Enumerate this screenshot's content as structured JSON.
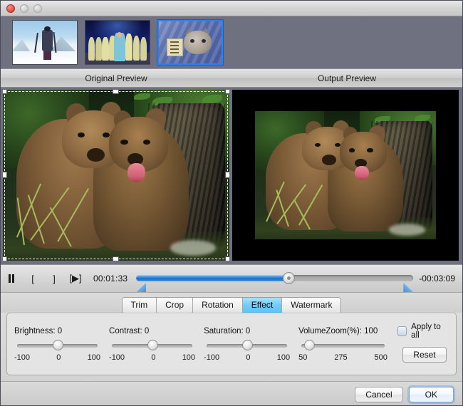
{
  "window": {
    "traffic_lights": [
      "close",
      "minimize",
      "zoom"
    ]
  },
  "thumbnails": [
    {
      "name": "skier-clip",
      "selected": false
    },
    {
      "name": "wedding-clip",
      "selected": false
    },
    {
      "name": "kitten-clip",
      "selected": true
    }
  ],
  "preview_header": {
    "original_label": "Original Preview",
    "output_label": "Output Preview"
  },
  "transport": {
    "pause_label": "‖",
    "mark_in_label": "[",
    "mark_out_label": "]",
    "play_segment_label": "[▶]",
    "current_time": "00:01:33",
    "remaining_time": "-00:03:09",
    "progress_percent": 55,
    "accent_color": "#2f86dd"
  },
  "tabs": [
    {
      "label": "Trim",
      "active": false
    },
    {
      "label": "Crop",
      "active": false
    },
    {
      "label": "Rotation",
      "active": false
    },
    {
      "label": "Effect",
      "active": true
    },
    {
      "label": "Watermark",
      "active": false
    }
  ],
  "effect_panel": {
    "sliders": [
      {
        "label": "Brightness: 0",
        "value": 0,
        "min_label": "-100",
        "mid_label": "0",
        "max_label": "100",
        "thumb_percent": 50
      },
      {
        "label": "Contrast: 0",
        "value": 0,
        "min_label": "-100",
        "mid_label": "0",
        "max_label": "100",
        "thumb_percent": 50
      },
      {
        "label": "Saturation: 0",
        "value": 0,
        "min_label": "-100",
        "mid_label": "0",
        "max_label": "100",
        "thumb_percent": 50
      },
      {
        "label": "VolumeZoom(%): 100",
        "value": 100,
        "min_label": "50",
        "mid_label": "275",
        "max_label": "500",
        "thumb_percent": 12
      }
    ],
    "apply_to_all_label": "Apply to all",
    "apply_to_all_checked": false,
    "reset_label": "Reset"
  },
  "footer": {
    "cancel_label": "Cancel",
    "ok_label": "OK"
  }
}
